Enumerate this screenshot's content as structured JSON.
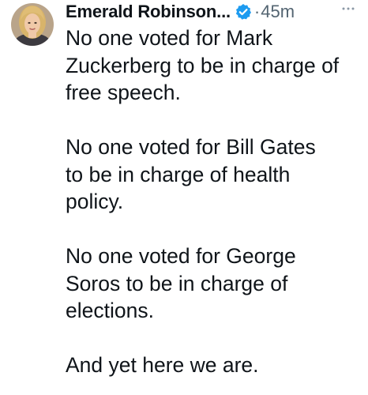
{
  "author": {
    "name": "Emerald Robinson...",
    "separator": "·",
    "time": "45m"
  },
  "icons": {
    "verified": "verified-badge-icon",
    "more": "more-options-icon",
    "avatar": "user-avatar"
  },
  "colors": {
    "verified_blue": "#1d9bf0",
    "text": "#0f1419",
    "muted": "#536471"
  },
  "paragraphs": [
    {
      "lines": [
        "No one voted for Mark",
        "Zuckerberg to be in charge of",
        "free speech."
      ]
    },
    {
      "lines": [
        "No one voted for Bill Gates",
        "to be in charge of health",
        "policy."
      ]
    },
    {
      "lines": [
        "No one voted for George",
        "Soros to be in charge of",
        "elections."
      ]
    },
    {
      "lines": [
        "And yet here we are."
      ]
    }
  ]
}
